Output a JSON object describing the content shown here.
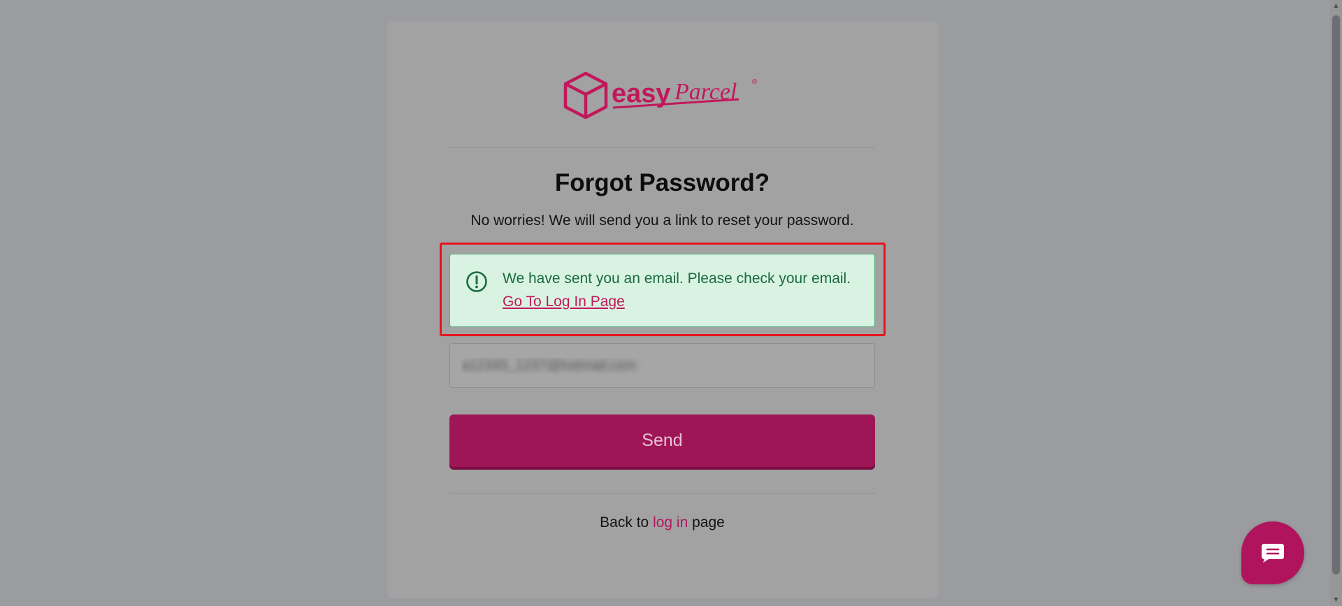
{
  "brand": {
    "logo_word_easy": "easy",
    "logo_word_parcel": "Parcel",
    "logo_registered": "®",
    "color": "#c2185b"
  },
  "page": {
    "title": "Forgot Password?",
    "subtitle": "No worries! We will send you a link to reset your password."
  },
  "alert": {
    "icon": "exclamation-circle-icon",
    "message": "We have sent you an email. Please check your email.",
    "link_label": "Go To Log In Page"
  },
  "form": {
    "email_value": "a12345_1237@hotmail.com",
    "send_label": "Send"
  },
  "footer": {
    "back_prefix": "Back to",
    "back_link": "log in",
    "back_suffix": "page"
  },
  "scrollbar": {
    "up_glyph": "▲",
    "down_glyph": "▼"
  },
  "chat": {
    "icon": "chat-bubble-icon"
  }
}
